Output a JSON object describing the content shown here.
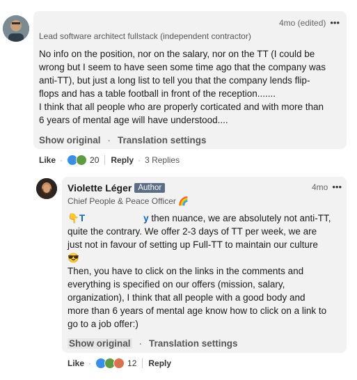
{
  "comment1": {
    "timestamp": "4mo (edited)",
    "headline": "Lead software architect fullstack (independent contractor)",
    "body_lines": [
      "No info on the position, nor on the salary, nor on the TT (I could be",
      "wrong but I seem to have seen some time ago that the company was",
      "anti-TT), but just a long list to tell you that the company lends flip-",
      "flops and has a table football in front of the reception.......",
      "I think that all people who are properly corticated and with more than",
      "6 years of mental age will have understood...."
    ],
    "show_original": "Show original",
    "translation_settings": "Translation settings",
    "like_label": "Like",
    "reaction_count": "20",
    "reply_label": "Reply",
    "replies_label": "3 Replies"
  },
  "comment2": {
    "name": "Violette Léger",
    "badge": "Author",
    "headline": "Chief People & Peace Officer 🌈",
    "timestamp": "4mo",
    "mention_start": "T",
    "mention_end": "y",
    "first_line_rest": " then nuance, we are absolutely not anti-TT,",
    "body_lines": [
      "quite the contrary. We offer 2-3 days of TT per week, we are",
      "just not in favour of setting up Full-TT to maintain our culture",
      "😎",
      "Then, you have to click on the links in the comments and",
      "everything is specified on our offers (mission, salary,",
      "organization), I think that all people with a good body and",
      "more than 6 years of mental age know how to click on a link to",
      "go to a job offer:)"
    ],
    "show_original": "Show original",
    "translation_settings": "Translation settings",
    "like_label": "Like",
    "reaction_count": "12",
    "reply_label": "Reply"
  },
  "icons": {
    "more": "more-horizontal-icon",
    "point_down": "👇"
  }
}
